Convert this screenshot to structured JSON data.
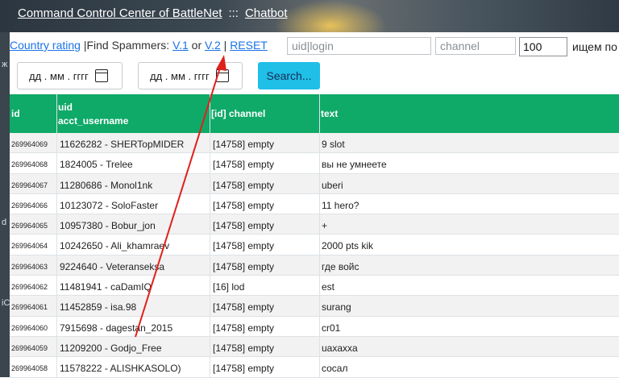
{
  "header": {
    "site_link": "Command Control Center of BattleNet",
    "separator": ":::",
    "chatbot_link": "Chatbot"
  },
  "left_strip": {
    "chars": [
      "ж",
      "d",
      "iC"
    ]
  },
  "filters": {
    "country_rating": "Country rating",
    "find_spammers": " |Find Spammers: ",
    "v1": "V.1",
    "or": " or ",
    "v2": "V.2",
    "bar": " | ",
    "reset": "RESET",
    "uid_placeholder": "uid|login",
    "channel_placeholder": "channel",
    "limit_value": "100",
    "trailing_text": "ищем по",
    "date_placeholder_1": "дд . мм . гггг",
    "date_placeholder_2": "дд . мм . гггг",
    "search_label": "Search..."
  },
  "table": {
    "headers": {
      "id": "id",
      "uid": "uid",
      "acct": "acct_username",
      "channel": "[id] channel",
      "text": "text"
    },
    "rows": [
      {
        "id": "269964069",
        "uid": "11626282 - SHERTopMIDER",
        "channel": "[14758] empty",
        "text": "9 slot"
      },
      {
        "id": "269964068",
        "uid": "1824005 - Trelee",
        "channel": "[14758] empty",
        "text": "вы не умнеете"
      },
      {
        "id": "269964067",
        "uid": "11280686 - Monol1nk",
        "channel": "[14758] empty",
        "text": "uberi"
      },
      {
        "id": "269964066",
        "uid": "10123072 - SoloFaster",
        "channel": "[14758] empty",
        "text": "11 hero?"
      },
      {
        "id": "269964065",
        "uid": "10957380 - Bobur_jon",
        "channel": "[14758] empty",
        "text": "+"
      },
      {
        "id": "269964064",
        "uid": "10242650 - Ali_khamraev",
        "channel": "[14758] empty",
        "text": "2000 pts kik"
      },
      {
        "id": "269964063",
        "uid": "9224640 - Veteranseksa",
        "channel": "[14758] empty",
        "text": "где войс"
      },
      {
        "id": "269964062",
        "uid": "11481941 - caDamIQ",
        "channel": "[16] lod",
        "text": "est"
      },
      {
        "id": "269964061",
        "uid": "11452859 - isa.98",
        "channel": "[14758] empty",
        "text": "surang"
      },
      {
        "id": "269964060",
        "uid": "7915698 - dagestan_2015",
        "channel": "[14758] empty",
        "text": "cr01"
      },
      {
        "id": "269964059",
        "uid": "11209200 - Godjo_Free",
        "channel": "[14758] empty",
        "text": "uaxaxxa"
      },
      {
        "id": "269964058",
        "uid": "11578222 - ALISHKASOLO)",
        "channel": "[14758] empty",
        "text": "сосал"
      }
    ]
  },
  "colors": {
    "header_green": "#0fa968",
    "search_button": "#1fbfe8",
    "link_blue": "#1a73e8",
    "annotation_arrow": "#e0201b"
  }
}
